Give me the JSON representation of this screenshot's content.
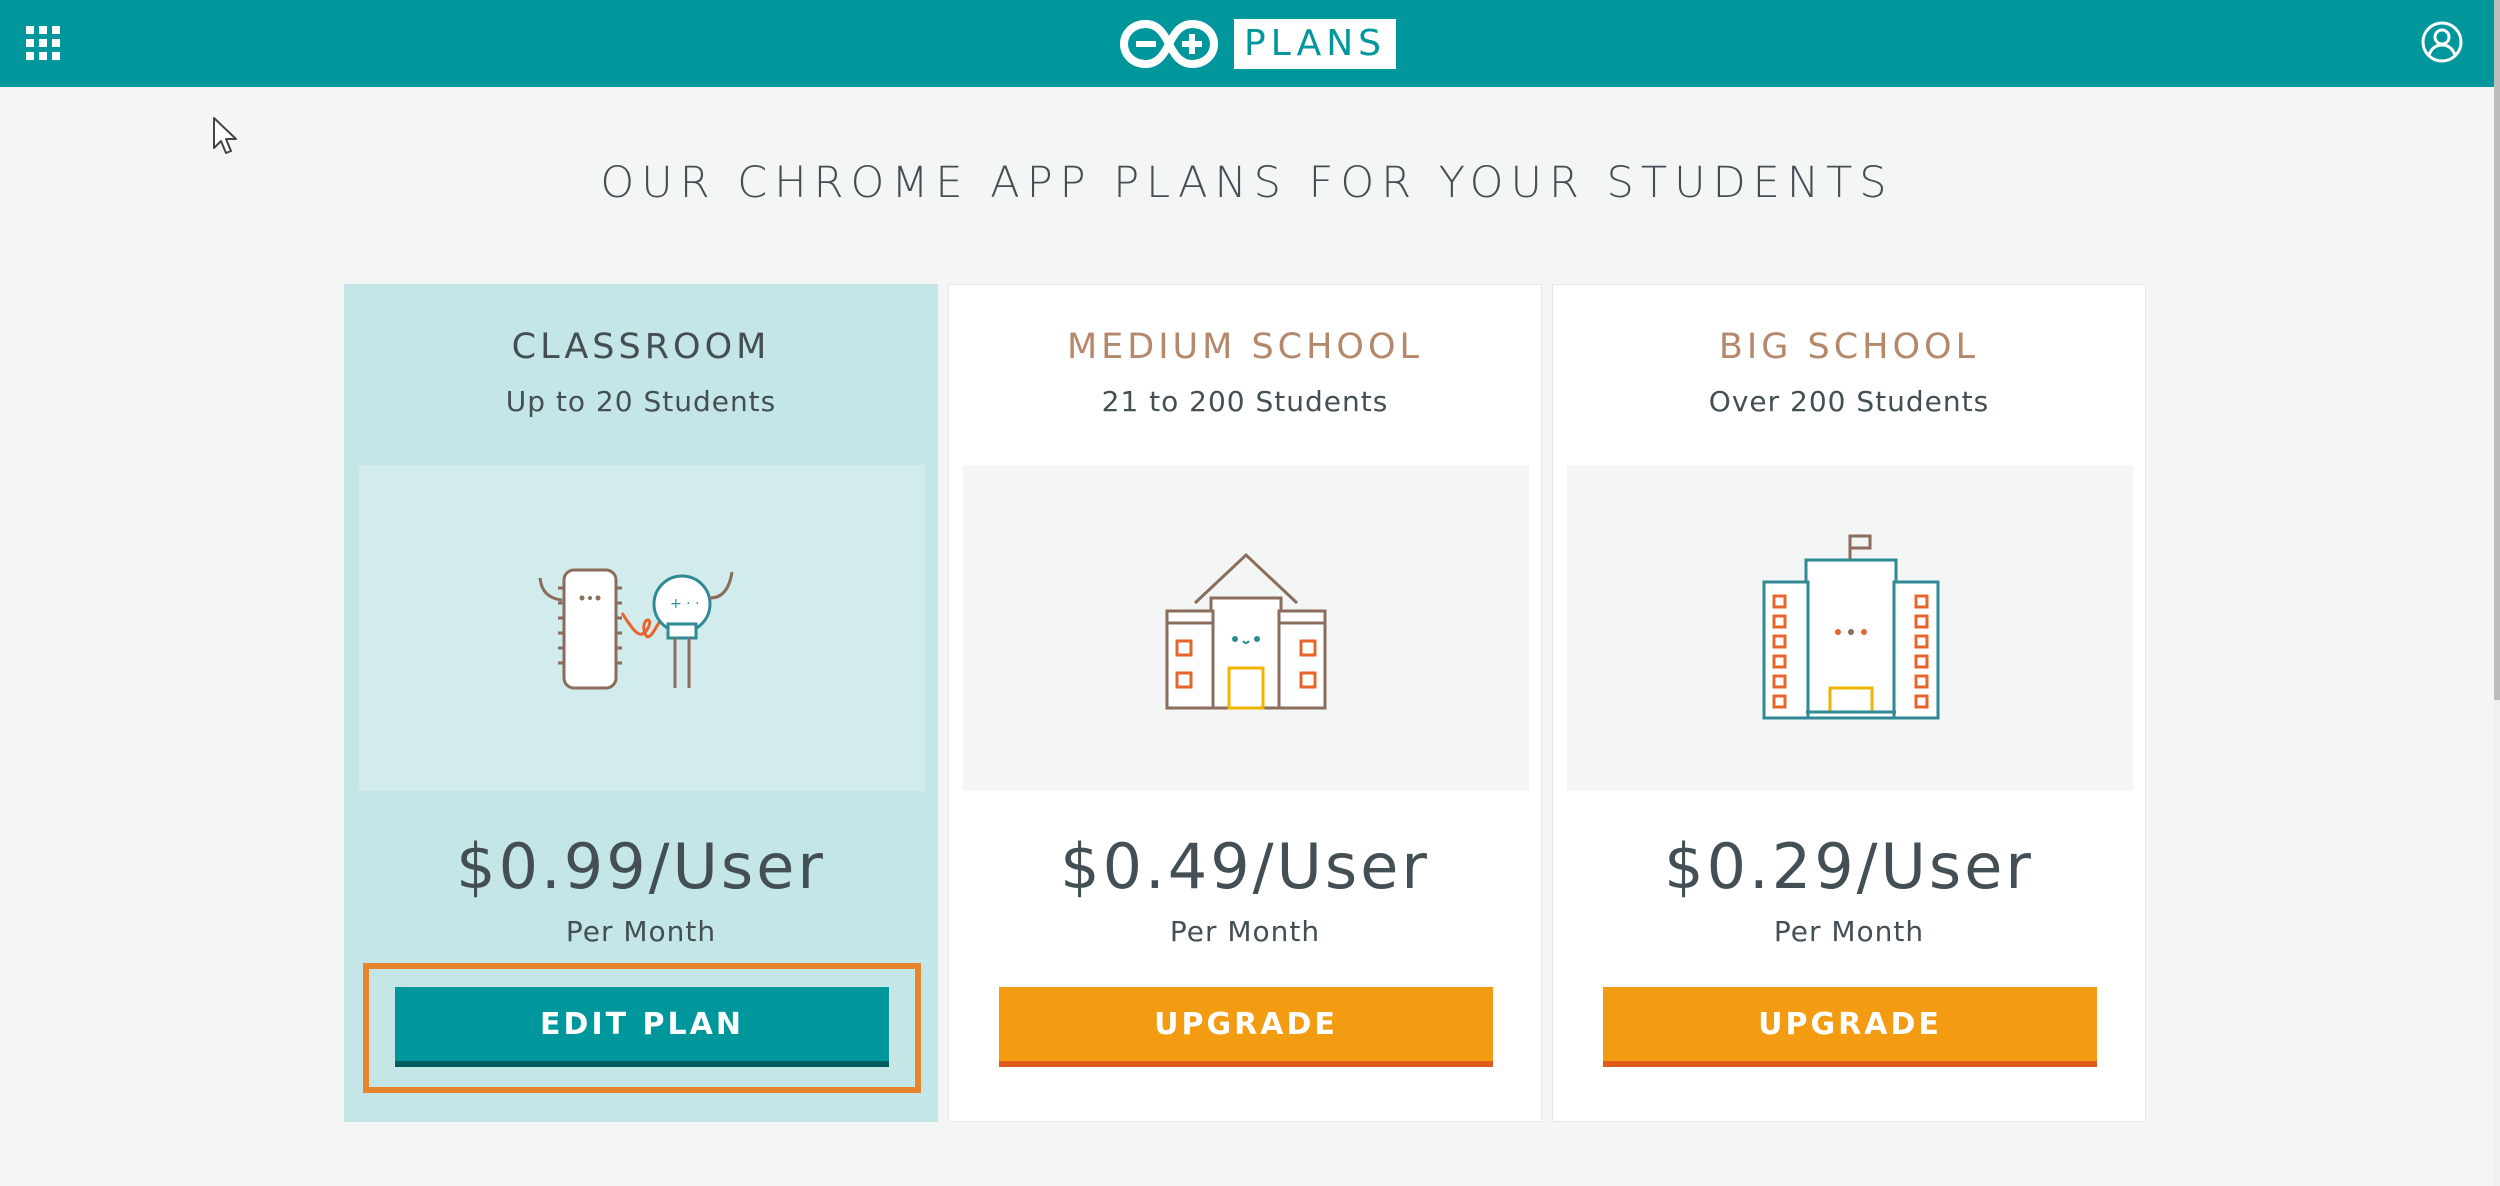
{
  "header": {
    "logo_icon": "arduino-infinity-logo-icon",
    "plans_label": "PLANS",
    "apps_icon": "apps-grid-icon",
    "user_icon": "user-account-icon",
    "bar_color": "#00979c"
  },
  "page": {
    "title": "OUR CHROME APP PLANS FOR YOUR STUDENTS"
  },
  "plans": [
    {
      "name": "CLASSROOM",
      "subtitle": "Up to 20 Students",
      "price": "$0.99/User",
      "period": "Per Month",
      "button_label": "EDIT PLAN",
      "selected": true,
      "illustration_icon": "classroom-characters-icon"
    },
    {
      "name": "MEDIUM SCHOOL",
      "subtitle": "21 to 200 Students",
      "price": "$0.49/User",
      "period": "Per Month",
      "button_label": "UPGRADE",
      "selected": false,
      "illustration_icon": "medium-school-building-icon"
    },
    {
      "name": "BIG SCHOOL",
      "subtitle": "Over 200 Students",
      "price": "$0.29/User",
      "period": "Per Month",
      "button_label": "UPGRADE",
      "selected": false,
      "illustration_icon": "big-school-building-icon"
    }
  ],
  "colors": {
    "teal": "#00979c",
    "orange_button": "#f39c12",
    "highlight": "#e8842c",
    "selected_card": "#c5e6e6"
  }
}
